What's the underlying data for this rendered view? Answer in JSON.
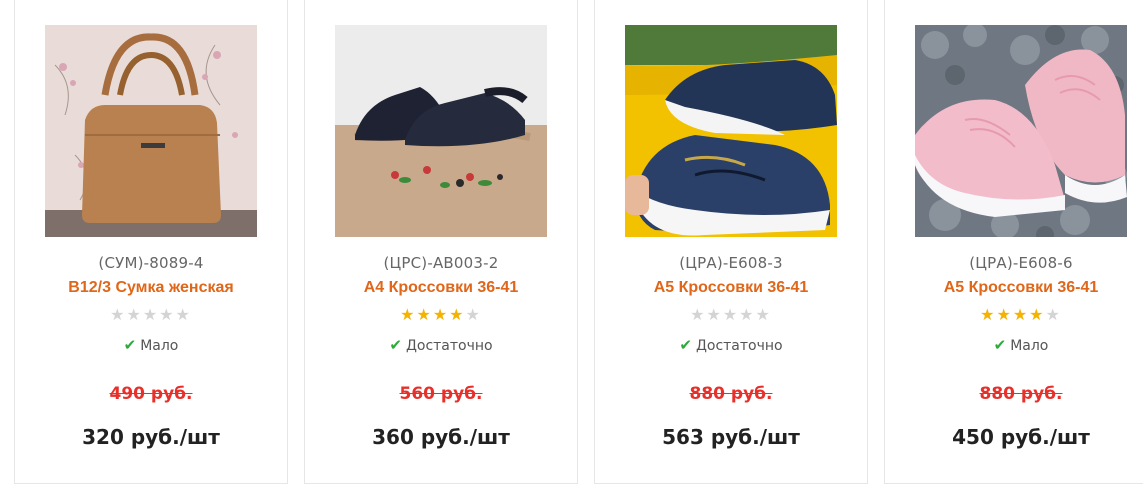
{
  "products": [
    {
      "sku": "(СУМ)-8089-4",
      "title": "В12/3 Сумка женская",
      "rating": 0,
      "stock": "Мало",
      "old_price": "490 руб.",
      "price": "320 руб./шт"
    },
    {
      "sku": "(ЦРС)-АВ003-2",
      "title": "А4 Кроссовки 36-41",
      "rating": 4,
      "stock": "Достаточно",
      "old_price": "560 руб.",
      "price": "360 руб./шт"
    },
    {
      "sku": "(ЦРА)-Е608-3",
      "title": "А5 Кроссовки 36-41",
      "rating": 0,
      "stock": "Достаточно",
      "old_price": "880 руб.",
      "price": "563 руб./шт"
    },
    {
      "sku": "(ЦРА)-Е608-6",
      "title": "А5 Кроссовки 36-41",
      "rating": 4,
      "stock": "Мало",
      "old_price": "880 руб.",
      "price": "450 руб./шт"
    }
  ],
  "rating_max": 5,
  "colors": {
    "title": "#e0671a",
    "old_price": "#e8302a",
    "star_on": "#f5b301",
    "star_off": "#d4d4d4",
    "check": "#2eaa3c"
  }
}
